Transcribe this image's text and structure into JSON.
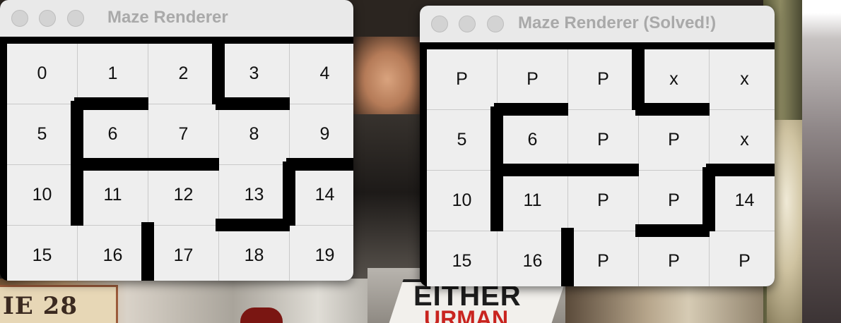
{
  "desktop": {
    "sign_text": "IE 28",
    "road_sign_text": "EITHER",
    "road_sign_text2": "URMAN"
  },
  "windows": [
    {
      "title": "Maze Renderer",
      "cells": [
        "0",
        "1",
        "2",
        "3",
        "4",
        "5",
        "6",
        "7",
        "8",
        "9",
        "10",
        "11",
        "12",
        "13",
        "14",
        "15",
        "16",
        "17",
        "18",
        "19"
      ]
    },
    {
      "title": "Maze Renderer (Solved!)",
      "cells": [
        "P",
        "P",
        "P",
        "x",
        "x",
        "5",
        "6",
        "P",
        "P",
        "x",
        "10",
        "11",
        "P",
        "P",
        "14",
        "15",
        "16",
        "P",
        "P",
        "P"
      ]
    }
  ]
}
